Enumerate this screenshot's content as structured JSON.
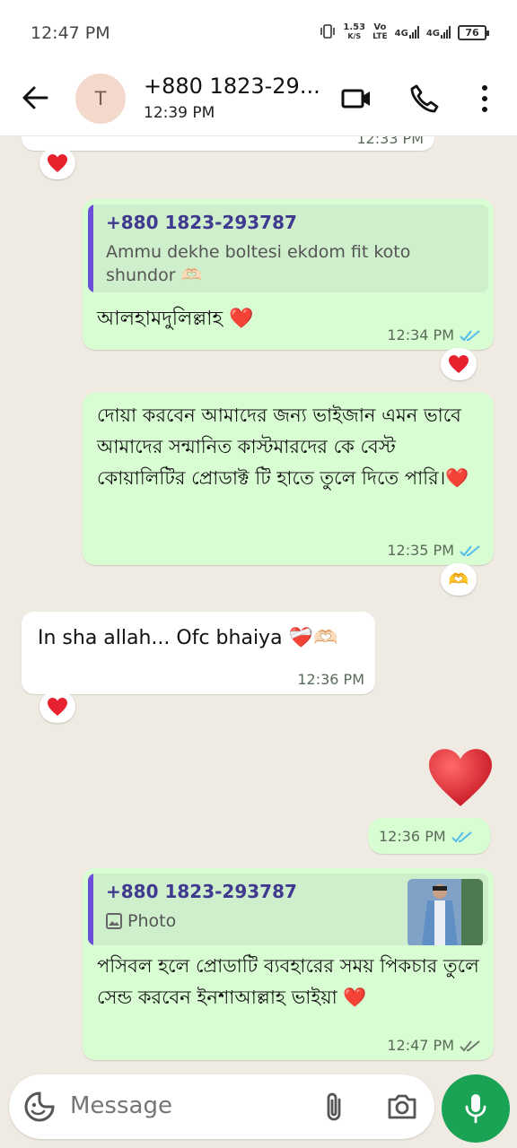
{
  "status_bar": {
    "time": "12:47 PM",
    "net_speed_value": "1.53",
    "net_speed_unit": "K/S",
    "vo": "Vo",
    "lte": "LTE",
    "net1": "4G",
    "net2": "4G",
    "battery": "76"
  },
  "header": {
    "avatar_letter": "T",
    "contact_name": "+880 1823-29...",
    "subtitle": "12:39 PM",
    "icons": [
      "back-arrow-icon",
      "video-call-icon",
      "phone-icon",
      "more-vert-icon"
    ]
  },
  "messages": [
    {
      "id": "m0",
      "direction": "incoming",
      "partial": true,
      "time": "12:33 PM",
      "reaction": "red-heart"
    },
    {
      "id": "m1",
      "direction": "outgoing",
      "quote_author": "+880 1823-293787",
      "quote_text": "Ammu dekhe boltesi ekdom fit koto shundor 🫶🏻",
      "text": "আলহামদুলিল্লাহ ❤️",
      "time": "12:34 PM",
      "status": "read",
      "reaction": "red-heart"
    },
    {
      "id": "m2",
      "direction": "outgoing",
      "text": "দোয়া করবেন আমাদের জন্য ভাইজান এমন ভাবে আমাদের সন্মানিত কাস্টমারদের কে বেস্ট কোয়ালিটির প্রোডাক্ট টি হাতে তুলে দিতে পারি।❤️",
      "time": "12:35 PM",
      "status": "read",
      "reaction": "heart-hands"
    },
    {
      "id": "m3",
      "direction": "incoming",
      "text": "In sha allah... Ofc bhaiya ❤️‍🩹🫶🏻",
      "time": "12:36 PM",
      "reaction": "red-heart"
    },
    {
      "id": "m4",
      "direction": "outgoing",
      "emoji_only": "❤️",
      "time": "12:36 PM",
      "status": "read"
    },
    {
      "id": "m5",
      "direction": "outgoing",
      "quote_author": "+880 1823-293787",
      "quote_text": "Photo",
      "quote_has_image": true,
      "text": "পসিবল হলে প্রোডাটি ব্যবহারের সময় পিকচার তুলে সেন্ড করবেন ইনশাআল্লাহ ভাইয়া ❤️",
      "time": "12:47 PM",
      "status": "delivered"
    }
  ],
  "composer": {
    "placeholder": "Message",
    "icons": [
      "emoji-icon",
      "attach-icon",
      "camera-icon",
      "mic-icon"
    ]
  },
  "colors": {
    "outgoing_bubble": "#d9fdd3",
    "incoming_bubble": "#ffffff",
    "chat_background": "#efeae2",
    "read_ticks": "#53bdeb",
    "quote_bar": "#6b4fd8",
    "mic_button": "#1aa255"
  }
}
